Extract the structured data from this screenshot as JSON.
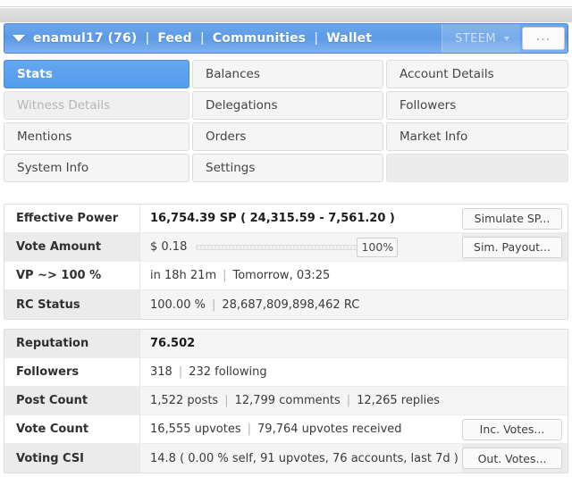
{
  "account_bar": {
    "caret_icon": "chevron-down-icon",
    "username": "enamul17 (76)",
    "separator": "|",
    "links": [
      "Feed",
      "Communities",
      "Wallet"
    ],
    "token_selector": {
      "label": "STEEM",
      "caret_icon": "chevron-down-small-icon"
    },
    "more_button_label": "...",
    "bar_color": "#5d9ae6"
  },
  "tabs": [
    {
      "label": "Stats",
      "state": "active"
    },
    {
      "label": "Balances",
      "state": "normal"
    },
    {
      "label": "Account Details",
      "state": "normal"
    },
    {
      "label": "Witness Details",
      "state": "disabled"
    },
    {
      "label": "Delegations",
      "state": "normal"
    },
    {
      "label": "Followers",
      "state": "normal"
    },
    {
      "label": "Mentions",
      "state": "normal"
    },
    {
      "label": "Orders",
      "state": "normal"
    },
    {
      "label": "Market Info",
      "state": "normal"
    },
    {
      "label": "System Info",
      "state": "normal"
    },
    {
      "label": "Settings",
      "state": "normal"
    },
    {
      "label": "",
      "state": "empty"
    }
  ],
  "stats_primary": {
    "effective_power": {
      "label": "Effective Power",
      "value": "16,754.39 SP ( 24,315.59 - 7,561.20 )",
      "action_label": "Simulate SP..."
    },
    "vote_amount": {
      "label": "Vote Amount",
      "dollar_value": "$ 0.18",
      "slider_percent_label": "100%",
      "slider_percent": 100,
      "action_label": "Sim. Payout..."
    },
    "vp_recovery": {
      "label": "VP ~> 100 %",
      "time_remaining": "in 18h 21m",
      "separator": "|",
      "eta": "Tomorrow, 03:25"
    },
    "rc_status": {
      "label": "RC Status",
      "percent": "100.00 %",
      "separator": "|",
      "amount": "28,687,809,898,462 RC"
    }
  },
  "stats_secondary": {
    "reputation": {
      "label": "Reputation",
      "value": "76.502"
    },
    "followers": {
      "label": "Followers",
      "count": "318",
      "separator": "|",
      "following": "232 following"
    },
    "post_count": {
      "label": "Post Count",
      "posts": "1,522 posts",
      "sep1": "|",
      "comments": "12,799 comments",
      "sep2": "|",
      "replies": "12,265 replies"
    },
    "vote_count": {
      "label": "Vote Count",
      "given": "16,555 upvotes",
      "separator": "|",
      "received": "79,764 upvotes received",
      "action_label": "Inc. Votes..."
    },
    "voting_csi": {
      "label": "Voting CSI",
      "value": "14.8 ( 0.00 % self, 91 upvotes, 76 accounts, last 7d )",
      "action_label": "Out. Votes..."
    }
  }
}
